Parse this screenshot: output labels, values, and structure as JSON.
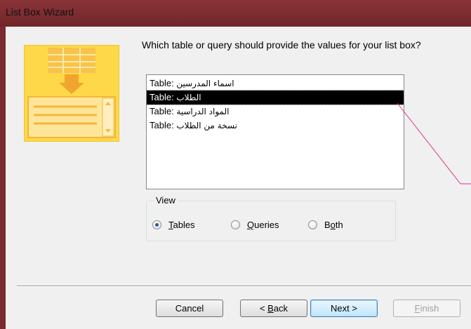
{
  "window": {
    "title": "List Box Wizard"
  },
  "prompt": "Which table or query should provide the values for your list box?",
  "list": {
    "items": [
      {
        "prefix": "Table: ",
        "name": "اسماء المدرسين",
        "selected": false
      },
      {
        "prefix": "Table: ",
        "name": "الطلاب",
        "selected": true
      },
      {
        "prefix": "Table: ",
        "name": "المواد الدراسية",
        "selected": false
      },
      {
        "prefix": "Table: ",
        "name": "نسخة من الطلاب",
        "selected": false
      }
    ]
  },
  "view": {
    "label": "View",
    "options": [
      {
        "mnemonic": "T",
        "rest": "ables",
        "checked": true
      },
      {
        "mnemonic": "Q",
        "rest": "ueries",
        "checked": false
      },
      {
        "prefix": "B",
        "mnemonic": "o",
        "rest": "th",
        "checked": false
      }
    ]
  },
  "buttons": {
    "cancel": "Cancel",
    "back_prefix": "< ",
    "back_mnemonic": "B",
    "back_rest": "ack",
    "next": "Next >",
    "finish_mnemonic": "F",
    "finish_rest": "inish"
  },
  "colors": {
    "title_bar": "#7a2b2f",
    "dialog_bg": "#f0f0f0",
    "selection": "#000000",
    "annotation_line": "#e0338a",
    "graphic_yellow": "#ffd84a"
  },
  "icons": {
    "wizard_graphic": "list-box-wizard-graphic"
  }
}
